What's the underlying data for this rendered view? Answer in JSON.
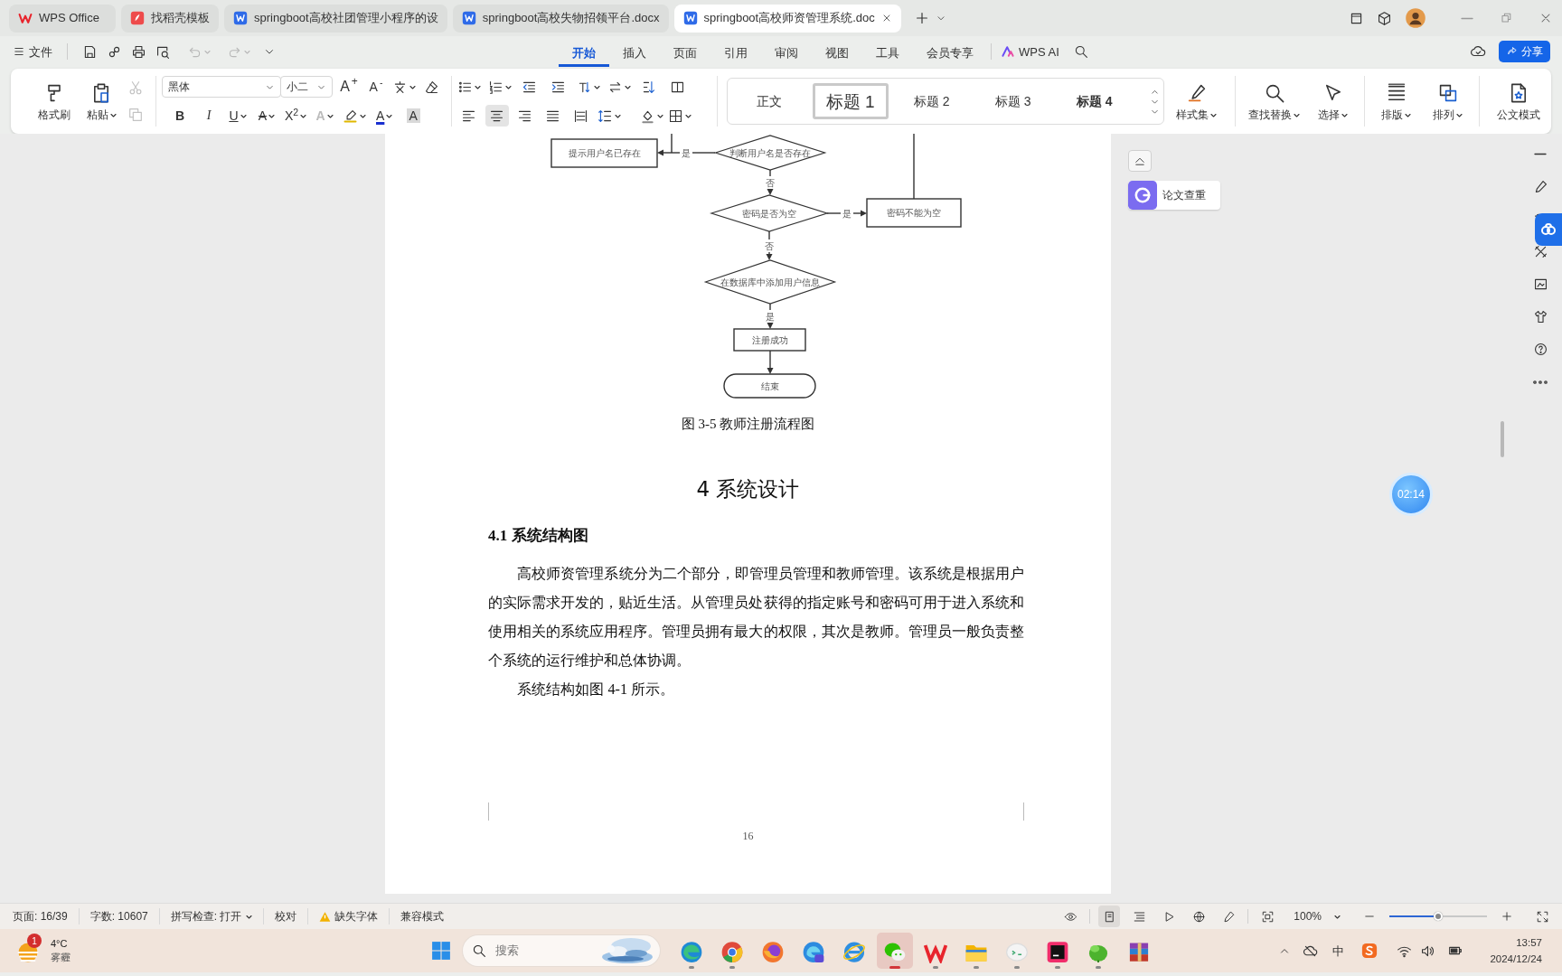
{
  "tabs": [
    {
      "kind": "wps",
      "label": "WPS Office",
      "selected": false
    },
    {
      "kind": "template",
      "label": "找稻壳模板",
      "selected": false
    },
    {
      "kind": "doc",
      "label": "springboot高校社团管理小程序的设",
      "selected": false
    },
    {
      "kind": "doc",
      "label": "springboot高校失物招领平台.docx",
      "selected": false
    },
    {
      "kind": "doc",
      "label": "springboot高校师资管理系统.doc",
      "selected": true
    }
  ],
  "file_menu": "文件",
  "undo": {
    "disabled": true
  },
  "redo": {
    "disabled": true
  },
  "menu_tabs": [
    {
      "label": "开始",
      "selected": true
    },
    {
      "label": "插入",
      "selected": false
    },
    {
      "label": "页面",
      "selected": false
    },
    {
      "label": "引用",
      "selected": false
    },
    {
      "label": "审阅",
      "selected": false
    },
    {
      "label": "视图",
      "selected": false
    },
    {
      "label": "工具",
      "selected": false
    },
    {
      "label": "会员专享",
      "selected": false
    }
  ],
  "ai_label": "WPS AI",
  "share_label": "分享",
  "ribbon": {
    "clipboard": [
      {
        "kind": "format_painter",
        "label": "格式刷",
        "dropdown": false
      },
      {
        "kind": "paste",
        "label": "粘贴",
        "dropdown": true
      }
    ],
    "edit_actions": [
      {
        "kind": "cut",
        "disabled": true
      },
      {
        "kind": "copy",
        "disabled": true
      }
    ],
    "font": {
      "name": "黑体",
      "size": "小二"
    },
    "font_buttons": [
      {
        "kind": "grow",
        "label": "A$^{+}$"
      },
      {
        "kind": "shrink",
        "label": "A$^{-}$"
      }
    ],
    "format_buttons": [
      {
        "kind": "bold",
        "label": "B",
        "dropdown": false
      },
      {
        "kind": "italic",
        "label": "I",
        "dropdown": false
      },
      {
        "kind": "underline",
        "label": "U",
        "dropdown": true
      },
      {
        "kind": "strike",
        "label": "A",
        "dropdown": true
      },
      {
        "kind": "superscript",
        "label": "X$^{2}$",
        "dropdown": true
      },
      {
        "kind": "outline",
        "label": "A",
        "dropdown": true
      },
      {
        "kind": "highlight",
        "dropdown": true
      },
      {
        "kind": "color",
        "label": "A",
        "dropdown": true
      },
      {
        "kind": "shade",
        "label": "A",
        "dropdown": false
      }
    ],
    "alignment": [
      {
        "selected": false
      },
      {
        "selected": true
      },
      {
        "selected": false
      },
      {
        "selected": false
      },
      {
        "selected": false
      }
    ],
    "styles": [
      {
        "label": "正文",
        "selected": false
      },
      {
        "label": "标题 1",
        "selected": true
      },
      {
        "label": "标题 2",
        "selected": false
      },
      {
        "label": "标题 3",
        "selected": false
      },
      {
        "label": "标题 4",
        "selected": false
      }
    ],
    "tools": [
      {
        "kind": "style_set",
        "label": "样式集",
        "dropdown": true
      },
      {
        "kind": "find",
        "label": "查找替换",
        "dropdown": true
      },
      {
        "kind": "select",
        "label": "选择",
        "dropdown": true
      },
      {
        "kind": "layout",
        "label": "排版",
        "dropdown": true
      },
      {
        "kind": "arrange",
        "label": "排列",
        "dropdown": true
      },
      {
        "kind": "official",
        "label": "公文模式",
        "dropdown": false
      }
    ]
  },
  "document": {
    "flowchart": {
      "nodes": [
        {
          "kind": "process",
          "label": "提示用户名已存在"
        },
        {
          "kind": "decision",
          "label": "判断用户名是否存在"
        },
        {
          "kind": "decision",
          "label": "密码是否为空"
        },
        {
          "kind": "process",
          "label": "密码不能为空"
        },
        {
          "kind": "decision",
          "label": "在数据库中添加用户信息"
        },
        {
          "kind": "process",
          "label": "注册成功"
        },
        {
          "kind": "terminal",
          "label": "结束"
        }
      ],
      "edges": [
        {
          "kind": "arrow",
          "label": "是"
        },
        {
          "kind": "arrow",
          "label": "否"
        },
        {
          "kind": "arrow",
          "label": "是"
        },
        {
          "kind": "arrow",
          "label": "否"
        },
        {
          "kind": "arrow",
          "label": "是"
        },
        {
          "kind": "arrow"
        }
      ]
    },
    "caption": "图 3-5  教师注册流程图",
    "heading": "4  系统设计",
    "subheading": "4.1 系统结构图",
    "paragraphs": [
      "高校师资管理系统分为二个部分，即管理员管理和教师管理。该系统是根据用户的实际需求开发的，贴近生活。从管理员处获得的指定账号和密码可用于进入系统和使用相关的系统应用程序。管理员拥有最大的权限，其次是教师。管理员一般负责整个系统的运行维护和总体协调。",
      "系统结构如图 4-1 所示。"
    ],
    "page_number": "16"
  },
  "side_panel": {
    "paper_check": "论文查重"
  },
  "timer": "02:14",
  "status_bar": {
    "items": [
      {
        "kind": "text",
        "label": "页面: 16/39"
      },
      {
        "kind": "text",
        "label": "字数: 10607"
      },
      {
        "kind": "dropdown",
        "label": "拼写检查: 打开"
      },
      {
        "kind": "text",
        "label": "校对"
      },
      {
        "kind": "warning",
        "label": "缺失字体"
      },
      {
        "kind": "text",
        "label": "兼容模式"
      }
    ],
    "views": [
      {
        "kind": "read",
        "selected": false
      },
      {
        "kind": "page",
        "selected": true
      },
      {
        "kind": "outline",
        "selected": false
      },
      {
        "kind": "play",
        "selected": false
      },
      {
        "kind": "web",
        "selected": false
      },
      {
        "kind": "pen",
        "selected": false
      },
      {
        "kind": "fit",
        "selected": false
      }
    ],
    "zoom": "100%",
    "zoom_slider": {
      "level": 0.5
    }
  },
  "taskbar": {
    "weather": {
      "badge": "1",
      "temperature": "4°C",
      "condition": "雾霾"
    },
    "search": {
      "placeholder": "搜索"
    },
    "apps": [
      {
        "kind": "edge",
        "running": true,
        "active": false
      },
      {
        "kind": "chrome",
        "running": true,
        "active": false
      },
      {
        "kind": "firefox",
        "running": false,
        "active": false
      },
      {
        "kind": "edge_ai",
        "running": false,
        "active": false
      },
      {
        "kind": "ie",
        "running": false,
        "active": false
      },
      {
        "kind": "wechat",
        "running": true,
        "active": true
      },
      {
        "kind": "wps",
        "running": true,
        "active": false
      },
      {
        "kind": "folder",
        "running": true,
        "active": false
      },
      {
        "kind": "chat",
        "running": true,
        "active": false
      },
      {
        "kind": "idea",
        "running": true,
        "active": false
      },
      {
        "kind": "green",
        "running": true,
        "active": false
      },
      {
        "kind": "archive",
        "running": false,
        "active": false
      }
    ],
    "ime": "中",
    "time": "13:57",
    "date": "2024/12/24"
  }
}
